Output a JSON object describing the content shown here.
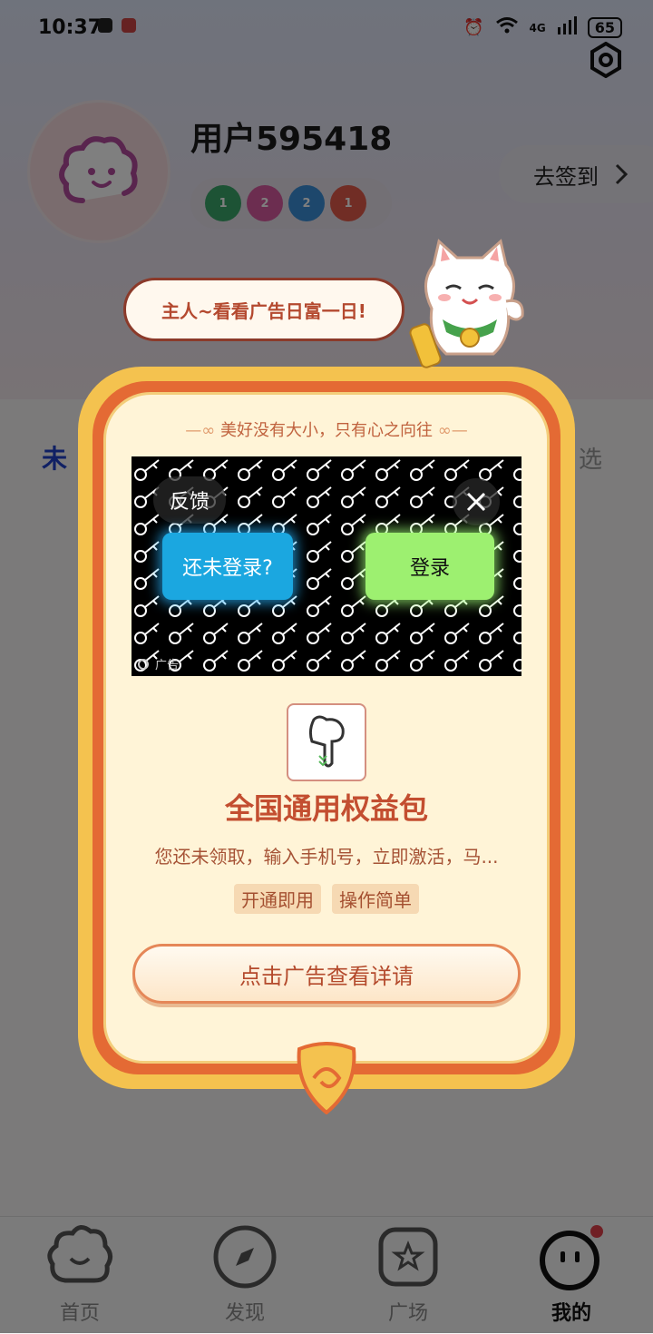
{
  "status_bar": {
    "time": "10:37",
    "network": "4G",
    "battery": "65"
  },
  "profile": {
    "username": "用户595418",
    "checkin_label": "去签到",
    "badges": [
      {
        "icon": "calendar-badge-icon",
        "count": "1",
        "color": "#3aa66a"
      },
      {
        "icon": "fish-badge-icon",
        "count": "2",
        "color": "#d85aa0"
      },
      {
        "icon": "medal-badge-icon",
        "count": "2",
        "color": "#3a8fd8"
      },
      {
        "icon": "calendar-red-badge-icon",
        "count": "1",
        "color": "#e35b4b"
      }
    ]
  },
  "tabs": {
    "left_visible": "未",
    "right_visible": "选"
  },
  "popup": {
    "speech": "主人~看看广告日富一日!",
    "motto": "美好没有大小，只有心之向往",
    "ad": {
      "feedback_label": "反馈",
      "not_logged_label": "还未登录?",
      "login_label": "登录",
      "ad_mark": "广告"
    },
    "offer_title": "全国通用权益包",
    "offer_desc": "您还未领取，输入手机号，立即激活，马...",
    "tags": [
      "开通即用",
      "操作简单"
    ],
    "cta_label": "点击广告查看详请"
  },
  "bottom_nav": {
    "items": [
      {
        "label": "首页",
        "icon": "home-flower-icon",
        "active": false
      },
      {
        "label": "发现",
        "icon": "compass-icon",
        "active": false
      },
      {
        "label": "广场",
        "icon": "star-square-icon",
        "active": false
      },
      {
        "label": "我的",
        "icon": "face-profile-icon",
        "active": true
      }
    ]
  },
  "colors": {
    "accent_blue": "#2140c8",
    "frame_gold": "#f4c24f",
    "frame_orange": "#e46a34",
    "offer_red": "#c34e30"
  }
}
